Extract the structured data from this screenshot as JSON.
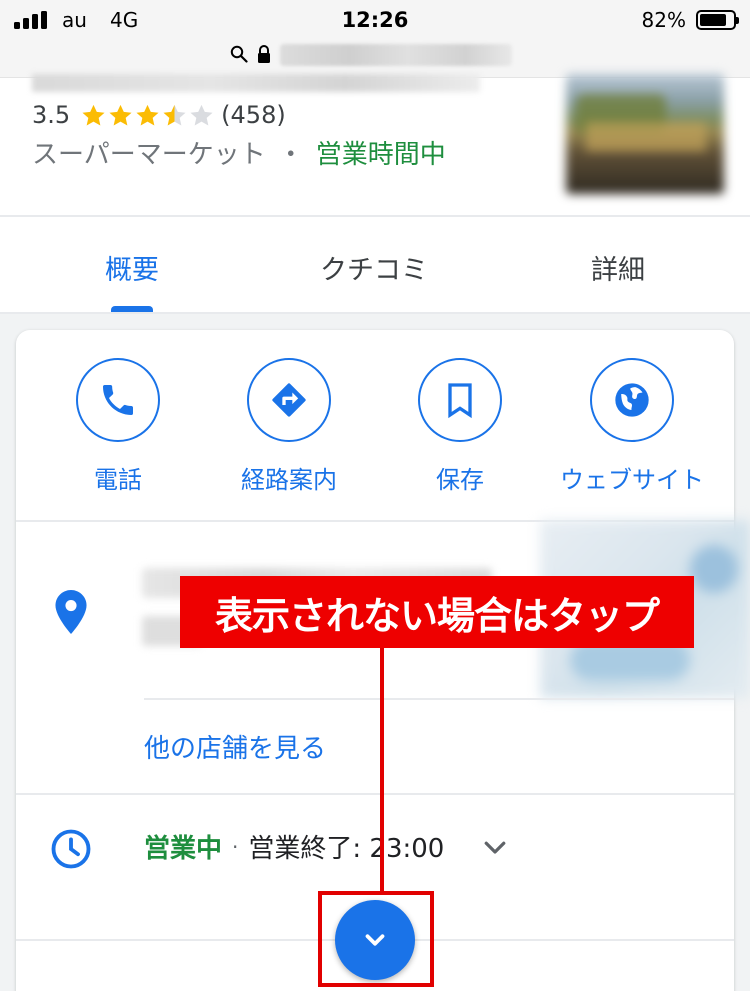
{
  "status_bar": {
    "carrier": "au",
    "network": "4G",
    "time": "12:26",
    "battery": "82%",
    "battery_level": 0.82
  },
  "place": {
    "rating": "3.5",
    "rating_value": 3.5,
    "review_count": "(458)",
    "category": "スーパーマーケット",
    "separator": "・",
    "open_status": "営業時間中"
  },
  "tabs": [
    {
      "label": "概要",
      "active": true
    },
    {
      "label": "クチコミ",
      "active": false
    },
    {
      "label": "詳細",
      "active": false
    }
  ],
  "actions": [
    {
      "label": "電話",
      "icon": "phone-icon"
    },
    {
      "label": "経路案内",
      "icon": "directions-icon"
    },
    {
      "label": "保存",
      "icon": "bookmark-icon"
    },
    {
      "label": "ウェブサイト",
      "icon": "globe-icon"
    }
  ],
  "location": {
    "other_stores_link": "他の店舗を見る"
  },
  "hours": {
    "open_now": "営業中",
    "separator": "·",
    "closing": "営業終了: 23:00"
  },
  "annotation": {
    "callout_text": "表示されない場合はタップ"
  },
  "colors": {
    "accent": "#1a73e8",
    "open_green": "#1e8e3e",
    "annotation_red": "#ee0000",
    "star": "#fbbc04"
  }
}
